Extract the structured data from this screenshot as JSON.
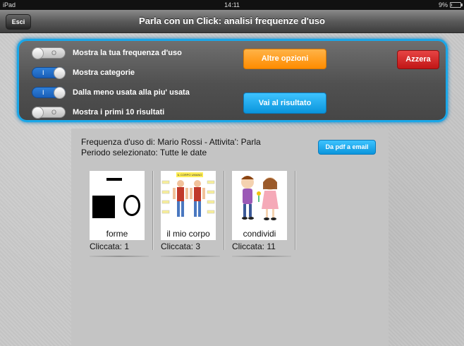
{
  "statusbar": {
    "device": "iPad",
    "time": "14:11",
    "battery": "9%",
    "battery_level": 0.09
  },
  "navbar": {
    "back_label": "Esci",
    "title": "Parla con un Click: analisi frequenze d'uso"
  },
  "options": [
    {
      "label": "Mostra la tua frequenza d'uso",
      "on": false,
      "mark": "O"
    },
    {
      "label": "Mostra categorie",
      "on": true,
      "mark": "I"
    },
    {
      "label": "Dalla meno usata alla piu' usata",
      "on": true,
      "mark": "I"
    },
    {
      "label": "Mostra i primi 10 risultati",
      "on": false,
      "mark": "O"
    }
  ],
  "buttons": {
    "altre_opzioni": "Altre opzioni",
    "vai_risultato": "Vai al risultato",
    "azzera": "Azzera",
    "pdf_email": "Da pdf a email"
  },
  "report": {
    "line1": "Frequenza d'uso di: Mario Rossi - Attivita': Parla",
    "line2": "Periodo selezionato: Tutte le date"
  },
  "cards": [
    {
      "caption": "forme",
      "count": "Cliccata: 1",
      "icon": "shapes-icon"
    },
    {
      "caption": "il mio corpo",
      "count": "Cliccata: 3",
      "icon": "body-icon",
      "pic_text": "IL CORPO UMANO"
    },
    {
      "caption": "condividi",
      "count": "Cliccata: 11",
      "icon": "sharing-icon"
    }
  ],
  "colors": {
    "panel_border": "#1aa7e8",
    "orange": "#ff8c00",
    "blue": "#0a95dc",
    "red": "#c11616"
  }
}
